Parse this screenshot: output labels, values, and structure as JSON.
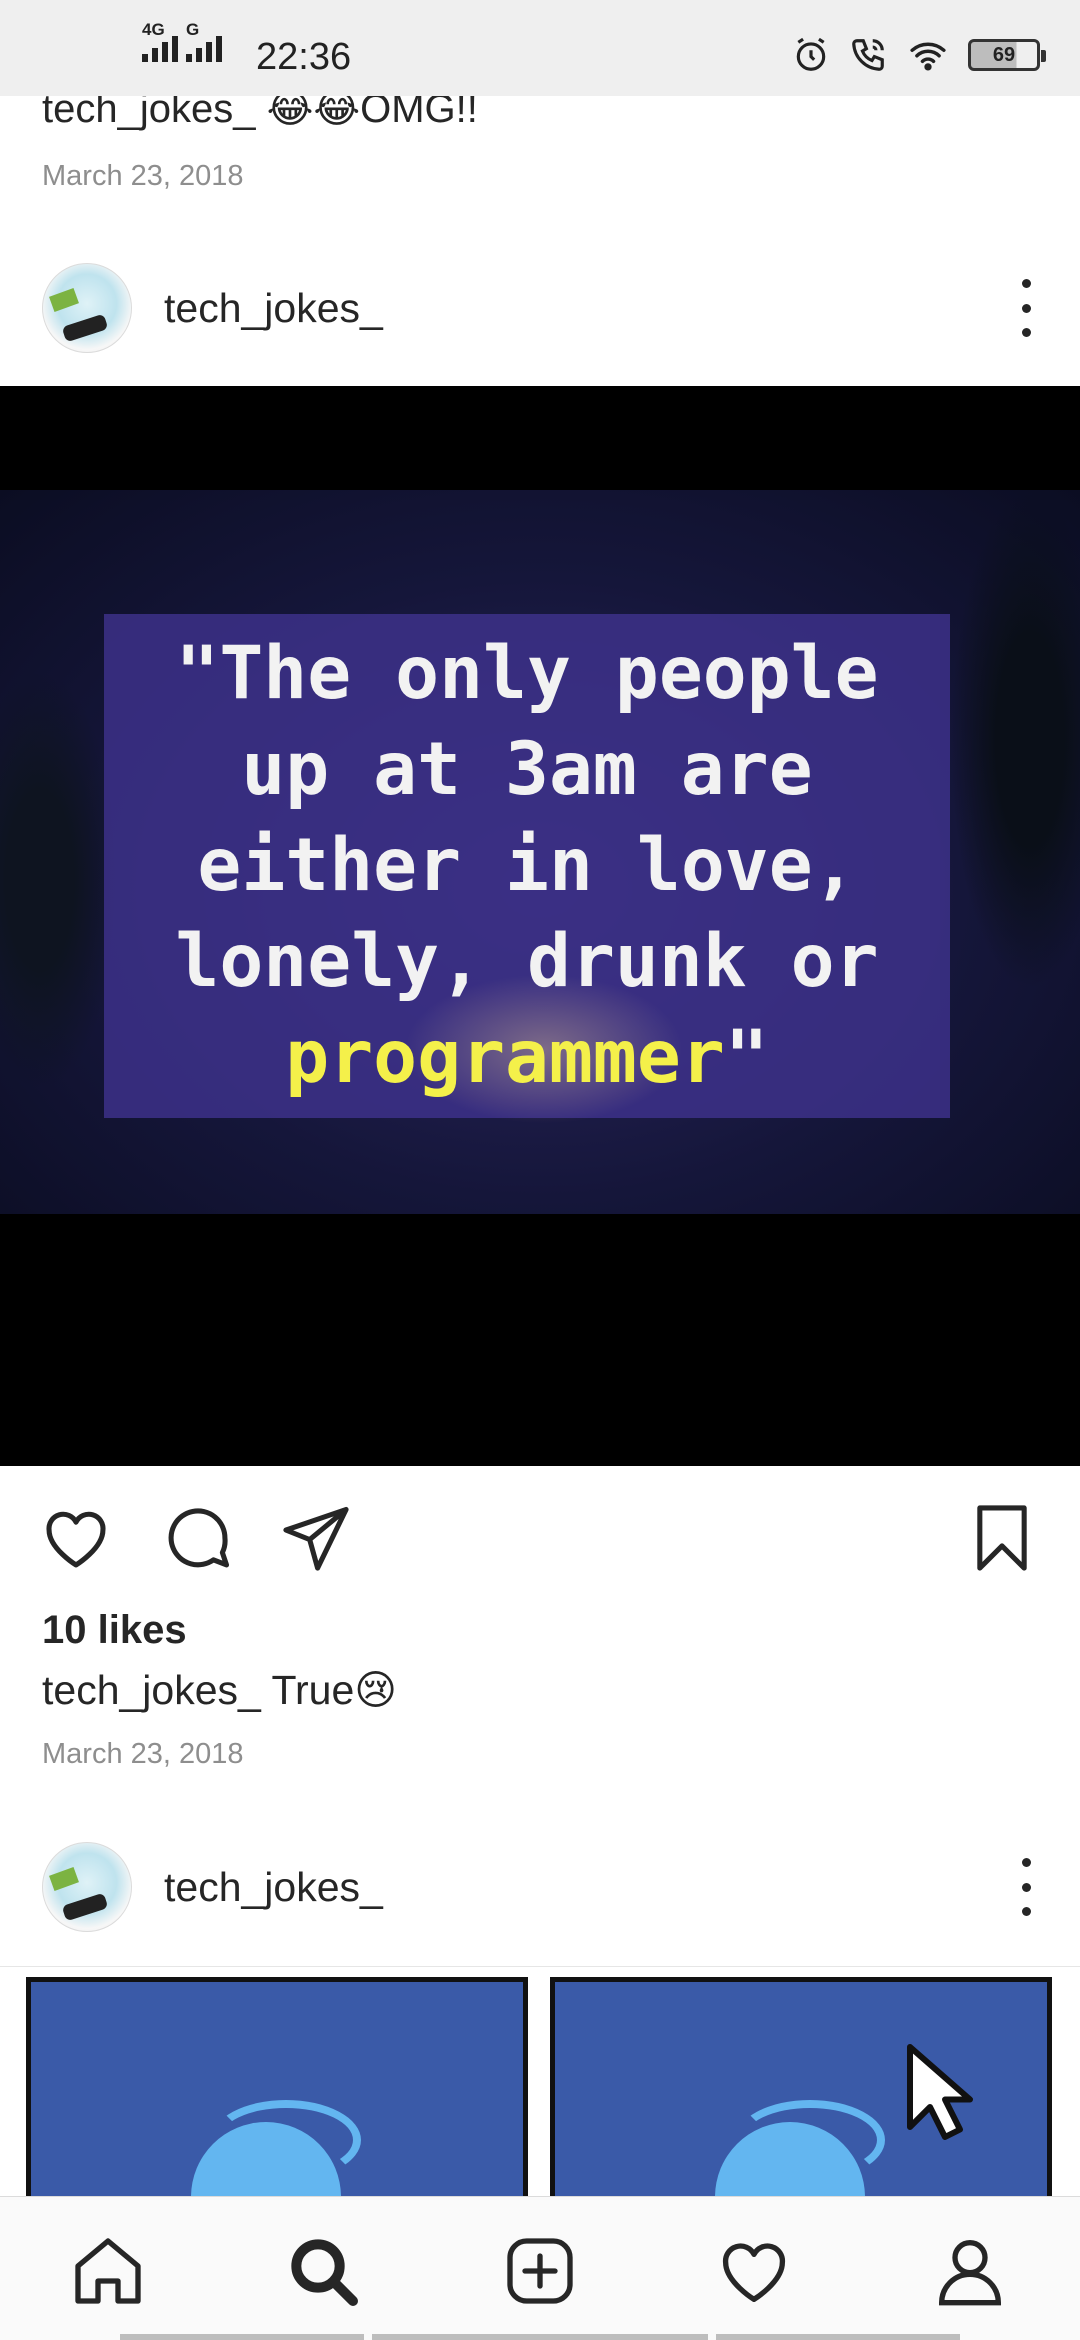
{
  "status_bar": {
    "net1": "4G",
    "net2": "G",
    "time": "22:36",
    "battery": "69",
    "icons": [
      "alarm-icon",
      "wifi-call-icon",
      "wifi-icon",
      "battery-icon"
    ]
  },
  "previous_post": {
    "caption_user": "tech_jokes_",
    "caption_text": "😂😂OMG!!",
    "date": "March 23, 2018"
  },
  "post": {
    "username": "tech_jokes_",
    "image_quote_lines": [
      "\"The only people",
      "up at 3am are",
      "either in love,",
      "lonely, drunk or"
    ],
    "image_quote_accent": "programmer",
    "image_quote_close": "\"",
    "likes": "10 likes",
    "caption_user": "tech_jokes_",
    "caption_text": "True😢",
    "date": "March 23, 2018",
    "actions": [
      "like-icon",
      "comment-icon",
      "share-icon",
      "save-icon"
    ]
  },
  "next_post": {
    "username": "tech_jokes_"
  },
  "bottom_nav": [
    "home-icon",
    "search-icon",
    "add-post-icon",
    "activity-icon",
    "profile-icon"
  ],
  "colors": {
    "text": "#262626",
    "muted": "#8e8e8e",
    "quote_accent": "#f4f04a"
  }
}
